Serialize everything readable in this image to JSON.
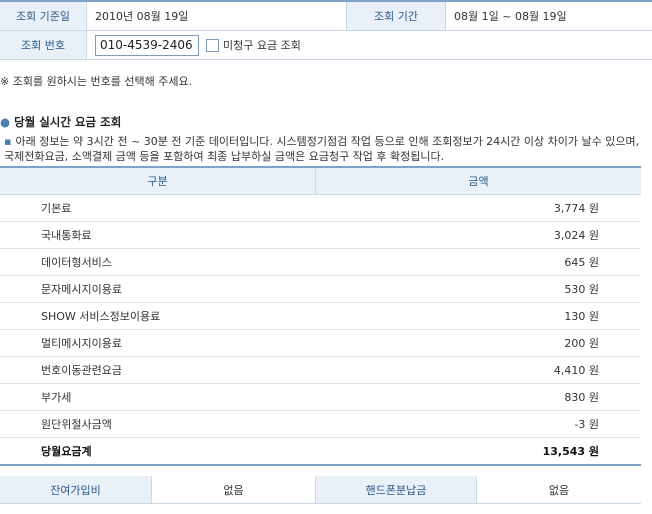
{
  "info": {
    "query_date_label": "조회 기준일",
    "query_date_value": "2010년 08월 19일",
    "query_period_label": "조회 기간",
    "query_period_value": "08월 1일 ~ 08월 19일",
    "number_label": "조회 번호",
    "number_value": "010-4539-2406",
    "unbilled_label": "미청구 요금 조회"
  },
  "note": "※ 조회를 원하시는 번호를 선택해 주세요.",
  "section_title": "당월 실시간 요금 조회",
  "description": "아래 정보는 약 3시간 전 ~ 30분 전 기준 데이터입니다. 시스템정기점검 작업 등으로 인해 조회정보가 24시간 이상 차이가 날수 있으며, 국제전화요금, 소액결제 금액 등을 포함하여 최종 납부하실 금액은 요금청구 작업 후 확정됩니다.",
  "charges": {
    "header_item": "구분",
    "header_amount": "금액",
    "rows": [
      {
        "item": "기본료",
        "amount": "3,774 원"
      },
      {
        "item": "국내통화료",
        "amount": "3,024 원"
      },
      {
        "item": "데이터형서비스",
        "amount": "645 원"
      },
      {
        "item": "문자메시지이용료",
        "amount": "530 원"
      },
      {
        "item": "SHOW 서비스정보이용료",
        "amount": "130 원"
      },
      {
        "item": "멀티메시지이용료",
        "amount": "200 원"
      },
      {
        "item": "번호이동관련요금",
        "amount": "4,410 원"
      },
      {
        "item": "부가세",
        "amount": "830 원"
      },
      {
        "item": "원단위절사금액",
        "amount": "-3 원"
      }
    ],
    "total_label": "당월요금계",
    "total_amount": "13,543 원"
  },
  "bottom": {
    "fee1_label": "잔여가입비",
    "fee1_value": "없음",
    "fee2_label": "핸드폰분납금",
    "fee2_value": "없음"
  },
  "colors": {
    "header_bg": "#e9f0f7",
    "header_text": "#2a5a8a",
    "border_accent": "#7da3c9"
  }
}
